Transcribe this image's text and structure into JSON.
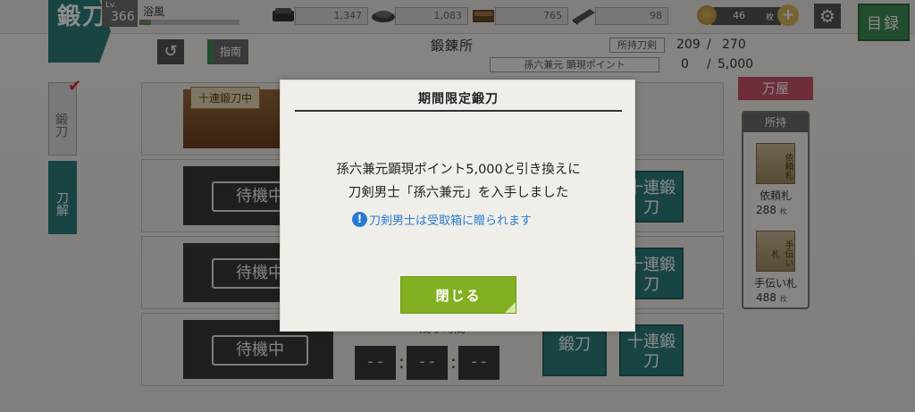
{
  "top_bar": {
    "forge_tab_label": "鍛刀",
    "level_prefix": "Lv.",
    "level": "366",
    "player_name": "浴風",
    "exp_progress": 0.12,
    "resources": [
      {
        "name": "charcoal",
        "value": "1,347"
      },
      {
        "name": "steel",
        "value": "1,083"
      },
      {
        "name": "coolant",
        "value": "765"
      },
      {
        "name": "whetstone",
        "value": "98"
      }
    ],
    "coins": "46",
    "coin_unit": "枚",
    "coin_plus": "+",
    "settings_icon": "gear-icon",
    "catalog_label": "目録"
  },
  "header": {
    "back_icon": "back-arrow-icon",
    "back_glyph": "↺",
    "guide_label": "指南",
    "title": "鍛錬所",
    "owned_swords_label": "所持刀剣",
    "owned_swords": "209",
    "owned_swords_sep": "/",
    "owned_swords_max": "270",
    "points_label": "孫六兼元 顕現ポイント",
    "points": "0",
    "points_sep": "/",
    "points_max": "5,000"
  },
  "side_tabs": {
    "forge": "鍛刀",
    "dismantle": "刀解",
    "check": "✔"
  },
  "slots": [
    {
      "image_label": "十連鍛刀中",
      "status": "forging"
    },
    {
      "wait_label": "待機中",
      "ten_forge_label": "十連鍛刀"
    },
    {
      "wait_label": "待機中",
      "ten_forge_label": "十連鍛刀"
    },
    {
      "wait_label": "待機中",
      "forge_label": "鍛刀",
      "ten_forge_label": "十連鍛刀",
      "timer_label": "残り時間",
      "timer": [
        "--",
        "--",
        "--"
      ],
      "timer_sep": ":"
    }
  ],
  "shop": {
    "tab_label": "万屋",
    "inventory_title": "所持",
    "items": [
      {
        "name": "依頼札",
        "count": "288",
        "unit": "枚",
        "card_text": "依頼札"
      },
      {
        "name": "手伝い札",
        "count": "488",
        "unit": "枚",
        "card_text": "手伝い札"
      }
    ]
  },
  "modal": {
    "title": "期間限定鍛刀",
    "message_line1": "孫六兼元顕現ポイント5,000と引き換えに",
    "message_line2": "刀剣男士「孫六兼元」を入手しました",
    "note_icon": "!",
    "note": "刀剣男士は受取箱に贈られます",
    "close_label": "閉じる"
  },
  "colors": {
    "teal": "#2f7c7d",
    "close_green": "#82b022",
    "note_blue": "#2a7ad3",
    "shop_pink": "#c8536a"
  }
}
